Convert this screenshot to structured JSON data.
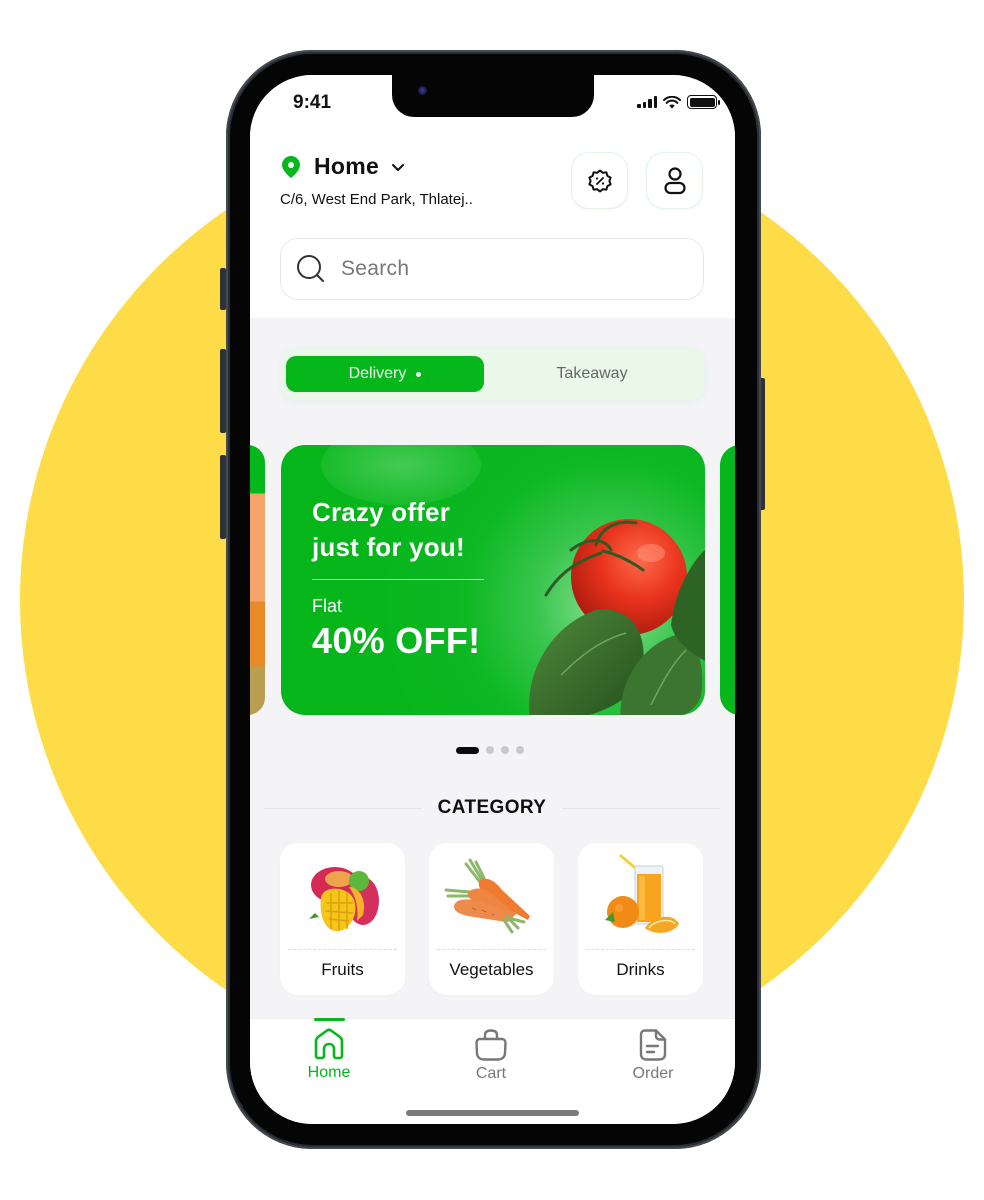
{
  "colors": {
    "background_circle": "#FDDC48",
    "brand_green": "#06B71B",
    "screen_bg": "#F4F4F6",
    "text_primary": "#111111",
    "text_muted": "#777777"
  },
  "status_bar": {
    "time": "9:41",
    "icons": [
      "cellular-signal-icon",
      "wifi-icon",
      "battery-icon"
    ]
  },
  "header": {
    "location_icon": "map-pin-icon",
    "location_title": "Home",
    "location_chevron": "chevron-down-icon",
    "address": "C/6, West End Park, Thlatej..",
    "actions": [
      {
        "name": "offers",
        "icon": "discount-badge-icon"
      },
      {
        "name": "profile",
        "icon": "user-icon"
      }
    ]
  },
  "search": {
    "icon": "search-icon",
    "placeholder": "Search",
    "value": ""
  },
  "order_mode": {
    "options": [
      {
        "label": "Delivery",
        "active": true
      },
      {
        "label": "Takeaway",
        "active": false
      }
    ]
  },
  "banner": {
    "title_line1": "Crazy offer",
    "title_line2": "just for you!",
    "subtitle": "Flat",
    "discount": "40% OFF!",
    "image": "tomato-basil-image",
    "carousel": {
      "total": 4,
      "active_index": 0
    }
  },
  "category": {
    "title": "CATEGORY",
    "items": [
      {
        "label": "Fruits",
        "image": "mango-image"
      },
      {
        "label": "Vegetables",
        "image": "carrots-image"
      },
      {
        "label": "Drinks",
        "image": "orange-juice-image"
      }
    ]
  },
  "bottom_nav": {
    "items": [
      {
        "label": "Home",
        "icon": "home-icon",
        "active": true
      },
      {
        "label": "Cart",
        "icon": "shopping-bag-icon",
        "active": false
      },
      {
        "label": "Order",
        "icon": "document-icon",
        "active": false
      }
    ]
  }
}
